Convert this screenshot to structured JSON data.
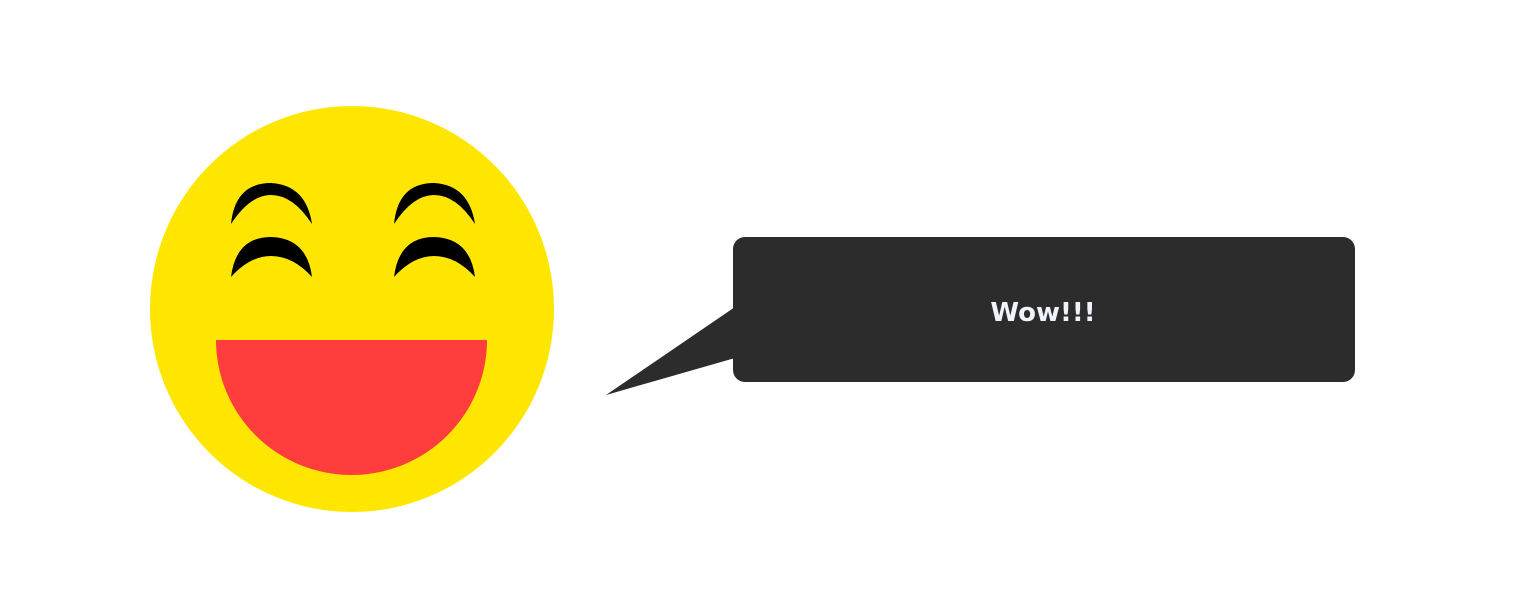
{
  "speech_bubble": {
    "text": "Wow!!!"
  },
  "colors": {
    "face": "#FFE600",
    "mouth": "#FF3D3D",
    "eyes": "#000000",
    "bubble": "#2C2C2C",
    "bubble_text": "#EEF4FA",
    "background": "#FFFFFF"
  },
  "icons": {
    "face": "laughing-emoji-icon"
  }
}
